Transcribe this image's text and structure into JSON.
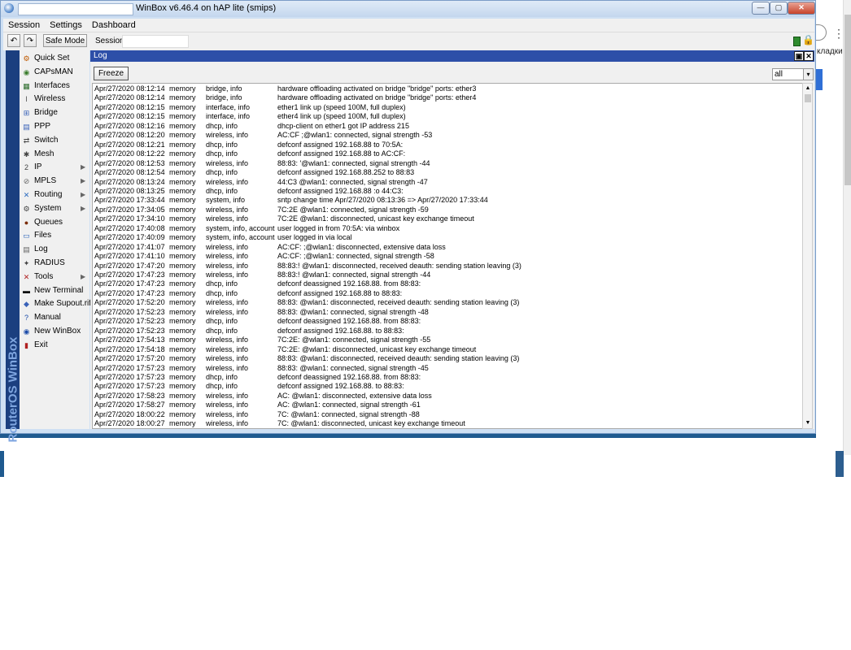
{
  "window": {
    "title": "WinBox v6.46.4 on hAP lite (smips)",
    "controls": [
      "—",
      "▢",
      "✕"
    ]
  },
  "menubar": [
    "Session",
    "Settings",
    "Dashboard"
  ],
  "toolbar": {
    "undo": "↶",
    "redo": "↷",
    "safe_mode": "Safe Mode",
    "session_label": "Session:",
    "session_value": ""
  },
  "sidebar": {
    "brand": "RouterOS WinBox",
    "items": [
      {
        "label": "Quick Set",
        "icon": "quick-set-icon",
        "glyph": "⚙",
        "color": "#c05a00",
        "submenu": false
      },
      {
        "label": "CAPsMAN",
        "icon": "capsman-icon",
        "glyph": "◉",
        "color": "#3a7d2c",
        "submenu": false
      },
      {
        "label": "Interfaces",
        "icon": "interfaces-icon",
        "glyph": "▦",
        "color": "#2a6a2a",
        "submenu": false
      },
      {
        "label": "Wireless",
        "icon": "wireless-icon",
        "glyph": "Ι",
        "color": "#555555",
        "submenu": false
      },
      {
        "label": "Bridge",
        "icon": "bridge-icon",
        "glyph": "⊞",
        "color": "#3a62b8",
        "submenu": false
      },
      {
        "label": "PPP",
        "icon": "ppp-icon",
        "glyph": "▤",
        "color": "#3a62b8",
        "submenu": false
      },
      {
        "label": "Switch",
        "icon": "switch-icon",
        "glyph": "⇄",
        "color": "#444444",
        "submenu": false
      },
      {
        "label": "Mesh",
        "icon": "mesh-icon",
        "glyph": "✱",
        "color": "#444444",
        "submenu": false
      },
      {
        "label": "IP",
        "icon": "ip-icon",
        "glyph": "2",
        "color": "#444444",
        "submenu": true
      },
      {
        "label": "MPLS",
        "icon": "mpls-icon",
        "glyph": "⊘",
        "color": "#666666",
        "submenu": true
      },
      {
        "label": "Routing",
        "icon": "routing-icon",
        "glyph": "✕",
        "color": "#2a6abf",
        "submenu": true
      },
      {
        "label": "System",
        "icon": "system-icon",
        "glyph": "⚙",
        "color": "#444444",
        "submenu": true
      },
      {
        "label": "Queues",
        "icon": "queues-icon",
        "glyph": "●",
        "color": "#7a2a00",
        "submenu": false
      },
      {
        "label": "Files",
        "icon": "files-icon",
        "glyph": "▭",
        "color": "#2a62b8",
        "submenu": false
      },
      {
        "label": "Log",
        "icon": "log-icon",
        "glyph": "▤",
        "color": "#666666",
        "submenu": false
      },
      {
        "label": "RADIUS",
        "icon": "radius-icon",
        "glyph": "✦",
        "color": "#444444",
        "submenu": false
      },
      {
        "label": "Tools",
        "icon": "tools-icon",
        "glyph": "✕",
        "color": "#b02020",
        "submenu": true
      },
      {
        "label": "New Terminal",
        "icon": "terminal-icon",
        "glyph": "▬",
        "color": "#000000",
        "submenu": false
      },
      {
        "label": "Make Supout.rif",
        "icon": "supout-icon",
        "glyph": "◆",
        "color": "#3a62b8",
        "submenu": false
      },
      {
        "label": "Manual",
        "icon": "manual-icon",
        "glyph": "?",
        "color": "#1a4aa8",
        "submenu": false
      },
      {
        "label": "New WinBox",
        "icon": "winbox-icon",
        "glyph": "◉",
        "color": "#1a4aa8",
        "submenu": false
      },
      {
        "label": "Exit",
        "icon": "exit-icon",
        "glyph": "▮",
        "color": "#b02020",
        "submenu": false
      }
    ]
  },
  "log": {
    "title": "Log",
    "freeze_label": "Freeze",
    "filter_value": "all",
    "rows": [
      [
        "Apr/27/2020 08:12:14",
        "memory",
        "bridge, info",
        "hardware offloading activated on bridge \"bridge\" ports: ether3"
      ],
      [
        "Apr/27/2020 08:12:14",
        "memory",
        "bridge, info",
        "hardware offloading activated on bridge \"bridge\" ports: ether4"
      ],
      [
        "Apr/27/2020 08:12:15",
        "memory",
        "interface, info",
        "ether1 link up (speed 100M, full duplex)"
      ],
      [
        "Apr/27/2020 08:12:15",
        "memory",
        "interface, info",
        "ether4 link up (speed 100M, full duplex)"
      ],
      [
        "Apr/27/2020 08:12:16",
        "memory",
        "dhcp, info",
        "dhcp-client on ether1 got IP address                 215"
      ],
      [
        "Apr/27/2020 08:12:20",
        "memory",
        "wireless, info",
        "AC:CF                  ;@wlan1: connected, signal strength -53"
      ],
      [
        "Apr/27/2020 08:12:21",
        "memory",
        "dhcp, info",
        "defconf assigned 192.168.88        to 70:5A:"
      ],
      [
        "Apr/27/2020 08:12:22",
        "memory",
        "dhcp, info",
        "defconf assigned 192.168.88        to AC:CF:"
      ],
      [
        "Apr/27/2020 08:12:53",
        "memory",
        "wireless, info",
        "88:83:            '@wlan1: connected, signal strength -44"
      ],
      [
        "Apr/27/2020 08:12:54",
        "memory",
        "dhcp, info",
        "defconf assigned 192.168.88.252 to 88:83"
      ],
      [
        "Apr/27/2020 08:13:24",
        "memory",
        "wireless, info",
        "44:C3                @wlan1: connected, signal strength -47"
      ],
      [
        "Apr/27/2020 08:13:25",
        "memory",
        "dhcp, info",
        "defconf assigned 192.168.88        :o 44:C3:"
      ],
      [
        "Apr/27/2020 17:33:44",
        "memory",
        "system, info",
        "sntp change time Apr/27/2020 08:13:36 => Apr/27/2020 17:33:44"
      ],
      [
        "Apr/27/2020 17:34:05",
        "memory",
        "wireless, info",
        "7C:2E                    @wlan1: connected, signal strength -59"
      ],
      [
        "Apr/27/2020 17:34:10",
        "memory",
        "wireless, info",
        "7C:2E                    @wlan1: disconnected, unicast key exchange timeout"
      ],
      [
        "Apr/27/2020 17:40:08",
        "memory",
        "system, info, account",
        "user           logged in from 70:5A:                    via winbox"
      ],
      [
        "Apr/27/2020 17:40:09",
        "memory",
        "system, info, account",
        "user           logged in via local"
      ],
      [
        "Apr/27/2020 17:41:07",
        "memory",
        "wireless, info",
        "AC:CF:                ;@wlan1: disconnected, extensive data loss"
      ],
      [
        "Apr/27/2020 17:41:10",
        "memory",
        "wireless, info",
        "AC:CF:                ;@wlan1: connected, signal strength -58"
      ],
      [
        "Apr/27/2020 17:47:20",
        "memory",
        "wireless, info",
        "88:83:!              @wlan1: disconnected, received deauth: sending station leaving (3)"
      ],
      [
        "Apr/27/2020 17:47:23",
        "memory",
        "wireless, info",
        "88:83:!              @wlan1: connected, signal strength -44"
      ],
      [
        "Apr/27/2020 17:47:23",
        "memory",
        "dhcp, info",
        "defconf deassigned 192.168.88.       from 88:83:"
      ],
      [
        "Apr/27/2020 17:47:23",
        "memory",
        "dhcp, info",
        "defconf assigned 192.168.88        to 88:83:"
      ],
      [
        "Apr/27/2020 17:52:20",
        "memory",
        "wireless, info",
        "88:83:                @wlan1: disconnected, received deauth: sending station leaving (3)"
      ],
      [
        "Apr/27/2020 17:52:23",
        "memory",
        "wireless, info",
        "88:83:                @wlan1: connected, signal strength -48"
      ],
      [
        "Apr/27/2020 17:52:23",
        "memory",
        "dhcp, info",
        "defconf deassigned 192.168.88.       from 88:83:"
      ],
      [
        "Apr/27/2020 17:52:23",
        "memory",
        "dhcp, info",
        "defconf assigned 192.168.88.        to 88:83:"
      ],
      [
        "Apr/27/2020 17:54:13",
        "memory",
        "wireless, info",
        "7C:2E:               @wlan1: connected, signal strength -55"
      ],
      [
        "Apr/27/2020 17:54:18",
        "memory",
        "wireless, info",
        "7C:2E:               @wlan1: disconnected, unicast key exchange timeout"
      ],
      [
        "Apr/27/2020 17:57:20",
        "memory",
        "wireless, info",
        "88:83:                @wlan1: disconnected, received deauth: sending station leaving (3)"
      ],
      [
        "Apr/27/2020 17:57:23",
        "memory",
        "wireless, info",
        "88:83:                @wlan1: connected, signal strength -45"
      ],
      [
        "Apr/27/2020 17:57:23",
        "memory",
        "dhcp, info",
        "defconf deassigned 192.168.88.       from 88:83:"
      ],
      [
        "Apr/27/2020 17:57:23",
        "memory",
        "dhcp, info",
        "defconf assigned 192.168.88.        to 88:83:"
      ],
      [
        "Apr/27/2020 17:58:23",
        "memory",
        "wireless, info",
        "AC:                    @wlan1: disconnected, extensive data loss"
      ],
      [
        "Apr/27/2020 17:58:27",
        "memory",
        "wireless, info",
        "AC:                    @wlan1: connected, signal strength -61"
      ],
      [
        "Apr/27/2020 18:00:22",
        "memory",
        "wireless, info",
        "7C:                    @wlan1: connected, signal strength -88"
      ],
      [
        "Apr/27/2020 18:00:27",
        "memory",
        "wireless, info",
        "7C:                    @wlan1: disconnected, unicast key exchange timeout"
      ]
    ]
  },
  "background": {
    "sidebar_text": "кладки",
    "menu_dots": "⋮"
  }
}
